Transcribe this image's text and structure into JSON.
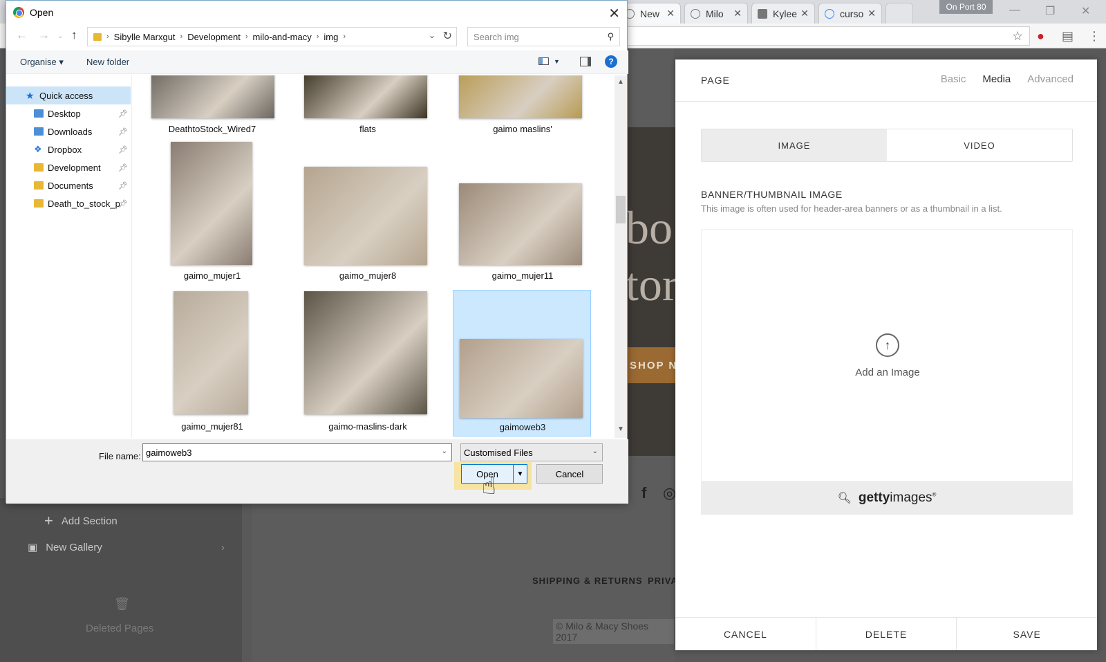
{
  "browser": {
    "tabs": [
      {
        "label": "New"
      },
      {
        "label": "Milo"
      },
      {
        "label": "Kylee"
      },
      {
        "label": "curso"
      }
    ],
    "port_badge": "On Port 80"
  },
  "background_page": {
    "sidebar": {
      "add_section": "Add Section",
      "new_gallery": "New Gallery",
      "deleted_pages": "Deleted Pages"
    },
    "hero_text_line1": "bo",
    "hero_text_line2": "tor",
    "shop_button": "SHOP NO",
    "footer_links": [
      "SHIPPING & RETURNS",
      "PRIVA"
    ],
    "copyright": "© Milo & Macy Shoes 2017"
  },
  "page_panel": {
    "title": "PAGE",
    "tabs": [
      "Basic",
      "Media",
      "Advanced"
    ],
    "active_tab": "Media",
    "media_types": [
      "IMAGE",
      "VIDEO"
    ],
    "section_label": "BANNER/THUMBNAIL IMAGE",
    "section_desc": "This image is often used for header-area banners or as a thumbnail in a list.",
    "add_image_label": "Add an Image",
    "getty_bold": "getty",
    "getty_rest": "images",
    "footer_buttons": [
      "CANCEL",
      "DELETE",
      "SAVE"
    ]
  },
  "dialog": {
    "title": "Open",
    "breadcrumb": [
      "Sibylle Marxgut",
      "Development",
      "milo-and-macy",
      "img"
    ],
    "search_placeholder": "Search img",
    "toolbar": {
      "organise": "Organise ▾",
      "new_folder": "New folder"
    },
    "nav_items": [
      {
        "label": "Quick access",
        "kind": "star"
      },
      {
        "label": "Desktop",
        "kind": "folder-blue",
        "pinned": true
      },
      {
        "label": "Downloads",
        "kind": "folder-blue",
        "pinned": true
      },
      {
        "label": "Dropbox",
        "kind": "dropbox",
        "pinned": true
      },
      {
        "label": "Development",
        "kind": "folder",
        "pinned": true
      },
      {
        "label": "Documents",
        "kind": "folder",
        "pinned": true
      },
      {
        "label": "Death_to_stock_p",
        "kind": "folder",
        "pinned": true
      }
    ],
    "files": [
      {
        "name": "DeathtoStock_Wired7",
        "color": "#6b6660"
      },
      {
        "name": "flats",
        "color": "#3b3322"
      },
      {
        "name": "gaimo maslins'",
        "color": "#b89a52"
      },
      {
        "name": "gaimo_mujer1",
        "color": "#8a7c72"
      },
      {
        "name": "gaimo_mujer8",
        "color": "#b5a58f"
      },
      {
        "name": "gaimo_mujer11",
        "color": "#9c8a79"
      },
      {
        "name": "gaimo_mujer81",
        "color": "#b8ab9b"
      },
      {
        "name": "gaimo-maslins-dark",
        "color": "#5c5547"
      },
      {
        "name": "gaimoweb3",
        "color": "#b39f8c"
      }
    ],
    "selected_file": "gaimoweb3",
    "file_name_label": "File name:",
    "file_name_value": "gaimoweb3",
    "file_type": "Customised Files",
    "open_button": "Open",
    "cancel_button": "Cancel"
  }
}
